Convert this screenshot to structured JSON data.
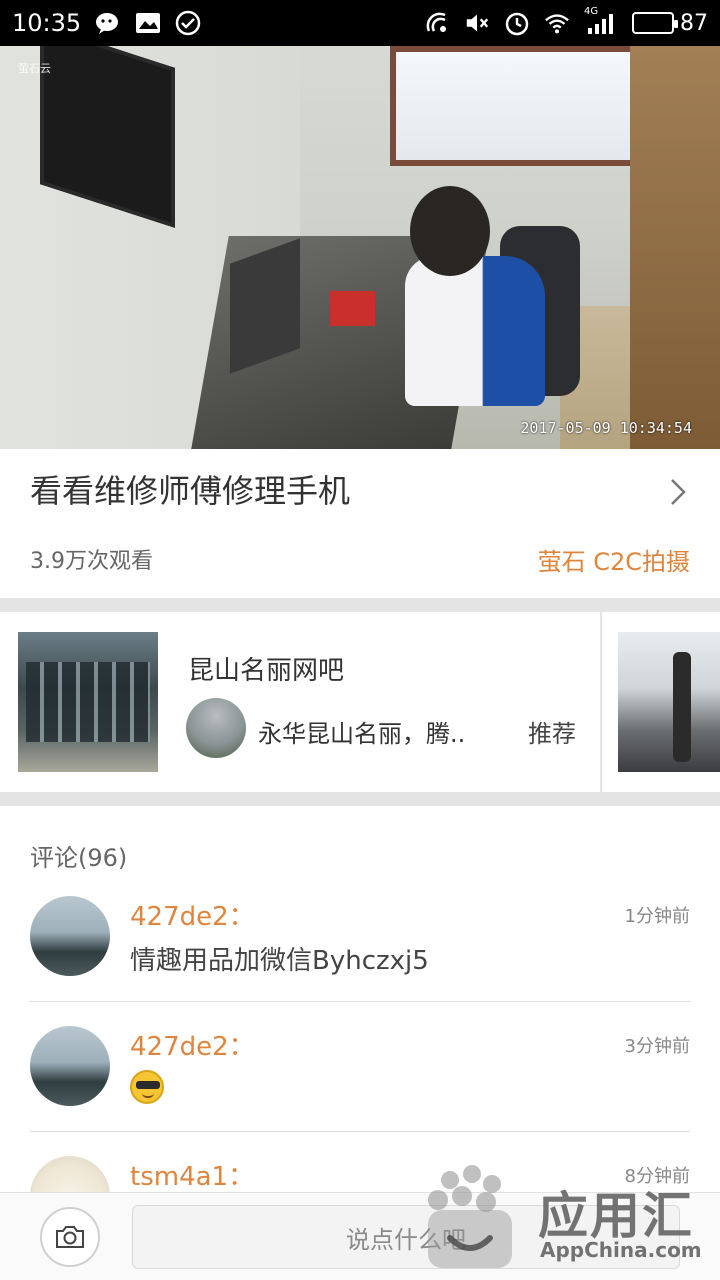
{
  "status_bar": {
    "time": "10:35",
    "network": "4G",
    "battery": "87",
    "battery_level": 0.87
  },
  "video": {
    "logo_text": "萤石云",
    "timestamp": "2017-05-09 10:34:54"
  },
  "header": {
    "title": "看看维修师傅修理手机",
    "views": "3.9万次观看",
    "source": "萤石 C2C拍摄"
  },
  "recommend": {
    "name": "昆山名丽网吧",
    "subtitle": "永华昆山名丽，腾..",
    "tag": "推荐"
  },
  "comments": {
    "header": "评论(96)",
    "items": [
      {
        "user": "427de2：",
        "time": "1分钟前",
        "text": "情趣用品加微信Byhczxj5",
        "emoji": ""
      },
      {
        "user": "427de2：",
        "time": "3分钟前",
        "text": "",
        "emoji": "sunglasses-emoji"
      },
      {
        "user": "tsm4a1：",
        "time": "8分钟前",
        "text": "",
        "emoji": ""
      }
    ]
  },
  "bottom_bar": {
    "input_placeholder": "说点什么吧"
  },
  "watermark": {
    "brand": "应用汇",
    "url": "AppChina.com"
  },
  "colors": {
    "accent": "#e0853e",
    "separator": "#e4e4e4"
  },
  "icons": [
    "wechat-icon",
    "gallery-icon",
    "check-circle-icon",
    "nfc-icon",
    "mute-icon",
    "alarm-icon",
    "wifi-icon",
    "signal-icon",
    "battery-icon",
    "chevron-right-icon",
    "camera-icon"
  ]
}
